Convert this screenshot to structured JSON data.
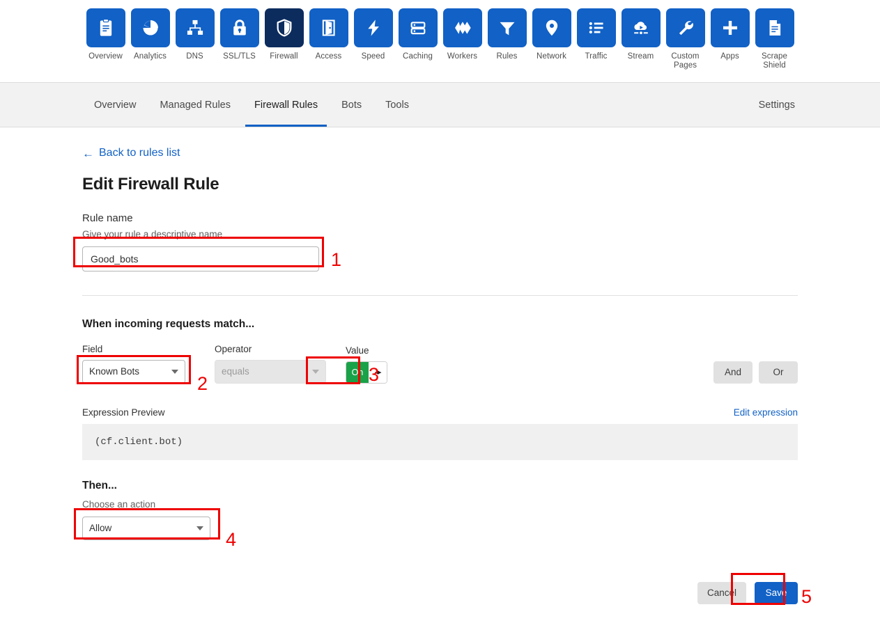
{
  "app_rail": {
    "items": [
      {
        "label": "Overview",
        "icon": "clipboard-icon",
        "active": false
      },
      {
        "label": "Analytics",
        "icon": "pie-chart-icon",
        "active": false
      },
      {
        "label": "DNS",
        "icon": "sitemap-icon",
        "active": false
      },
      {
        "label": "SSL/TLS",
        "icon": "lock-icon",
        "active": false
      },
      {
        "label": "Firewall",
        "icon": "shield-icon",
        "active": true
      },
      {
        "label": "Access",
        "icon": "door-icon",
        "active": false
      },
      {
        "label": "Speed",
        "icon": "lightning-bolt-icon",
        "active": false
      },
      {
        "label": "Caching",
        "icon": "server-stack-icon",
        "active": false
      },
      {
        "label": "Workers",
        "icon": "chevrons-icon",
        "active": false
      },
      {
        "label": "Rules",
        "icon": "funnel-icon",
        "active": false
      },
      {
        "label": "Network",
        "icon": "map-pin-icon",
        "active": false
      },
      {
        "label": "Traffic",
        "icon": "list-icon",
        "active": false
      },
      {
        "label": "Stream",
        "icon": "cloud-play-icon",
        "active": false
      },
      {
        "label": "Custom Pages",
        "icon": "wrench-icon",
        "active": false
      },
      {
        "label": "Apps",
        "icon": "plus-icon",
        "active": false
      },
      {
        "label": "Scrape Shield",
        "icon": "document-icon",
        "active": false
      }
    ]
  },
  "subnav": {
    "tabs": [
      {
        "label": "Overview",
        "active": false
      },
      {
        "label": "Managed Rules",
        "active": false
      },
      {
        "label": "Firewall Rules",
        "active": true
      },
      {
        "label": "Bots",
        "active": false
      },
      {
        "label": "Tools",
        "active": false
      }
    ],
    "settings_label": "Settings"
  },
  "page": {
    "back_link": "Back to rules list",
    "back_arrow": "←",
    "title": "Edit Firewall Rule"
  },
  "rule_name": {
    "label": "Rule name",
    "hint": "Give your rule a descriptive name",
    "value": "Good_bots",
    "placeholder": ""
  },
  "match_section": {
    "heading": "When incoming requests match...",
    "field_label": "Field",
    "field_value": "Known Bots",
    "operator_label": "Operator",
    "operator_value": "equals",
    "operator_disabled": true,
    "value_label": "Value",
    "toggle_state": "On",
    "toggle_knob_glyph": "◂▸",
    "and_label": "And",
    "or_label": "Or"
  },
  "expression": {
    "title": "Expression Preview",
    "edit_link": "Edit expression",
    "text": "(cf.client.bot)"
  },
  "then_section": {
    "heading": "Then...",
    "hint": "Choose an action",
    "action_value": "Allow"
  },
  "footer": {
    "cancel_label": "Cancel",
    "save_label": "Save"
  },
  "annotations": {
    "markers": [
      "1",
      "2",
      "3",
      "4",
      "5"
    ]
  },
  "colors": {
    "brand_blue": "#1161c6",
    "firewall_navy": "#0c2c5e",
    "toggle_green": "#1aa248",
    "annotation_red": "#ee0000",
    "subnav_bg": "#f2f2f2"
  }
}
